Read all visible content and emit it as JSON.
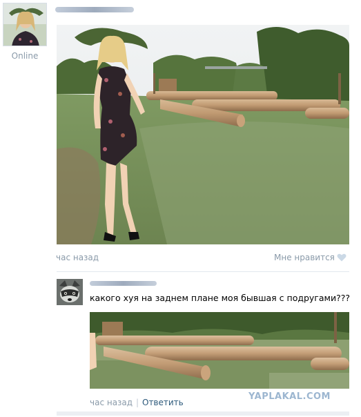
{
  "status": {
    "online_label": "Online"
  },
  "post": {
    "time": "час назад",
    "like_label": "Мне нравится"
  },
  "comment": {
    "text": "какого хуя на заднем плане моя бывшая с подругами???",
    "time": "час назад",
    "separator": "|",
    "reply_label": "Ответить"
  },
  "watermark": {
    "text": "YAPLAKAL.COM"
  },
  "icons": {
    "like": "heart-icon"
  },
  "colors": {
    "muted_text": "#8a9aa9",
    "link": "#2b587a",
    "watermark": "#9cb6d0"
  }
}
